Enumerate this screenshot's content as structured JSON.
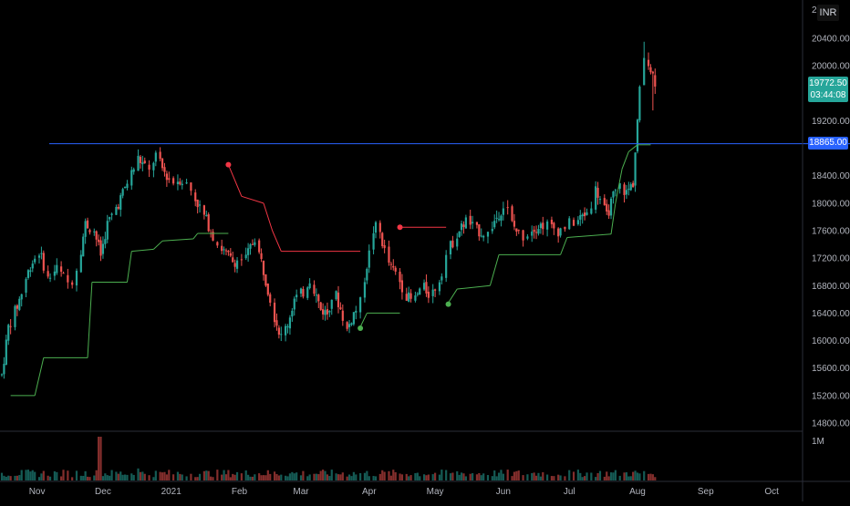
{
  "symbol_currency": "INR",
  "colors": {
    "background": "#000000",
    "up": "#26a69a",
    "down": "#ef5350",
    "supertrend_up": "#4caf50",
    "supertrend_down": "#f23645",
    "level_line": "#2962ff",
    "axis_text": "#b2b5be"
  },
  "chart_data": {
    "type": "candlestick",
    "price_axis": {
      "ylim": [
        14600,
        20900
      ],
      "ticks": [
        14800,
        15200,
        15600,
        16000,
        16400,
        16800,
        17200,
        17600,
        18000,
        18400,
        19200,
        20000,
        20400
      ],
      "tick_labels": [
        "14800.00",
        "15200.00",
        "15600.00",
        "16000.00",
        "16400.00",
        "16800.00",
        "17200.00",
        "17600.00",
        "18000.00",
        "18400.00",
        "19200.00",
        "20000.00",
        "20400.00"
      ],
      "top_partial_label": "20 00"
    },
    "time_axis": {
      "labels": [
        "Nov",
        "Dec",
        "2021",
        "Feb",
        "Mar",
        "Apr",
        "May",
        "Jun",
        "Jul",
        "Aug",
        "Sep",
        "Oct"
      ],
      "positions_day": [
        -1,
        29,
        60,
        91,
        119,
        150,
        180,
        211,
        241,
        272,
        303,
        333
      ]
    },
    "last_price": "19772.50",
    "countdown": "03:44:08",
    "horizontal_level": {
      "value": 18865,
      "label": "18865.00"
    },
    "volume_axis_label": "1M",
    "supertrend": [
      {
        "day": -13,
        "value": 15200,
        "trend": "up"
      },
      {
        "day": -2,
        "value": 15200,
        "trend": "up"
      },
      {
        "day": 2,
        "value": 15750,
        "trend": "up"
      },
      {
        "day": 22,
        "value": 15750,
        "trend": "up"
      },
      {
        "day": 24,
        "value": 16850,
        "trend": "up"
      },
      {
        "day": 40,
        "value": 16850,
        "trend": "up"
      },
      {
        "day": 42,
        "value": 17300,
        "trend": "up"
      },
      {
        "day": 52,
        "value": 17330,
        "trend": "up"
      },
      {
        "day": 56,
        "value": 17450,
        "trend": "up"
      },
      {
        "day": 70,
        "value": 17480,
        "trend": "up"
      },
      {
        "day": 72,
        "value": 17560,
        "trend": "up"
      },
      {
        "day": 86,
        "value": 17560,
        "trend": "up"
      },
      {
        "day": 86,
        "value": 18560,
        "trend": "down"
      },
      {
        "day": 92,
        "value": 18100,
        "trend": "down"
      },
      {
        "day": 102,
        "value": 18000,
        "trend": "down"
      },
      {
        "day": 106,
        "value": 17600,
        "trend": "down"
      },
      {
        "day": 110,
        "value": 17300,
        "trend": "down"
      },
      {
        "day": 146,
        "value": 17300,
        "trend": "down"
      },
      {
        "day": 146,
        "value": 16200,
        "trend": "up"
      },
      {
        "day": 149,
        "value": 16400,
        "trend": "up"
      },
      {
        "day": 164,
        "value": 16400,
        "trend": "up"
      },
      {
        "day": 164,
        "value": 17650,
        "trend": "down"
      },
      {
        "day": 185,
        "value": 17650,
        "trend": "down"
      },
      {
        "day": 186,
        "value": 16550,
        "trend": "up"
      },
      {
        "day": 190,
        "value": 16750,
        "trend": "up"
      },
      {
        "day": 205,
        "value": 16800,
        "trend": "up"
      },
      {
        "day": 209,
        "value": 17250,
        "trend": "up"
      },
      {
        "day": 237,
        "value": 17250,
        "trend": "up"
      },
      {
        "day": 240,
        "value": 17500,
        "trend": "up"
      },
      {
        "day": 260,
        "value": 17550,
        "trend": "up"
      },
      {
        "day": 262,
        "value": 18000,
        "trend": "up"
      },
      {
        "day": 265,
        "value": 18500,
        "trend": "up"
      },
      {
        "day": 268,
        "value": 18750,
        "trend": "up"
      },
      {
        "day": 272,
        "value": 18850,
        "trend": "up"
      },
      {
        "day": 278,
        "value": 18850,
        "trend": "up"
      }
    ],
    "supertrend_markers": [
      {
        "day": 86,
        "value": 18560,
        "trend": "down"
      },
      {
        "day": 146,
        "value": 16180,
        "trend": "up"
      },
      {
        "day": 164,
        "value": 17650,
        "trend": "down"
      },
      {
        "day": 186,
        "value": 16530,
        "trend": "up"
      }
    ]
  }
}
